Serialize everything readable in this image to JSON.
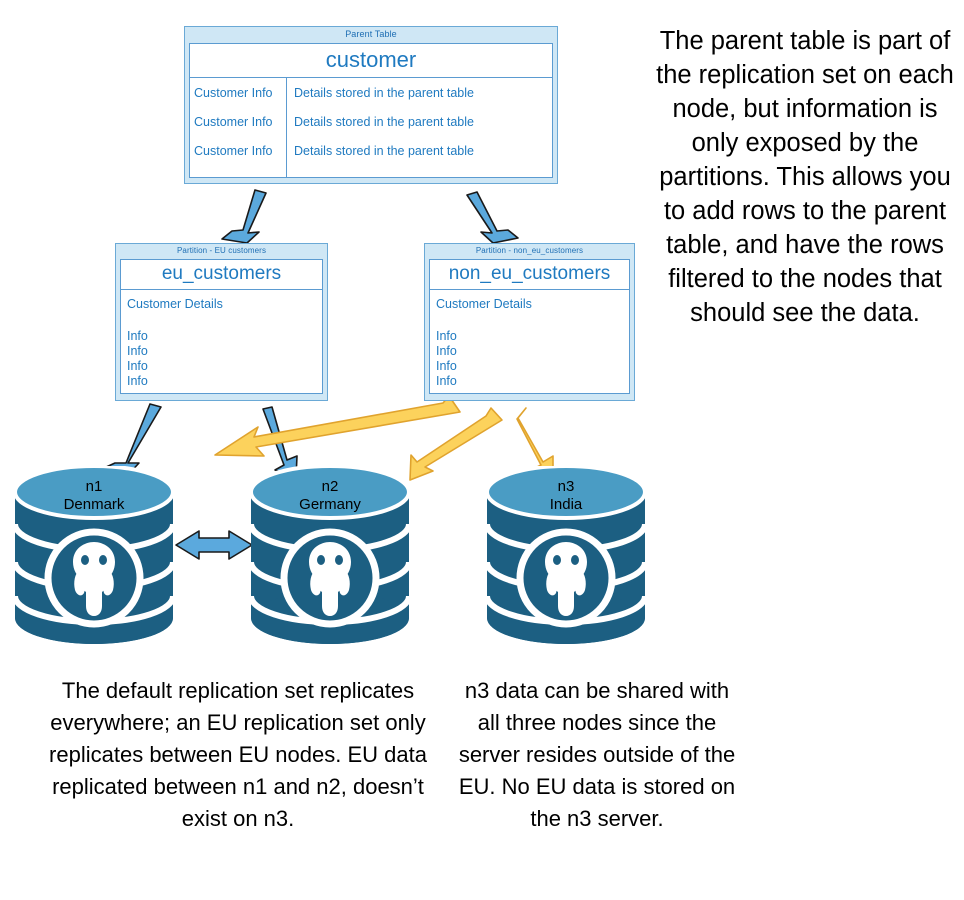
{
  "parent_table": {
    "caption": "Parent Table",
    "title": "customer",
    "rows": [
      {
        "label": "Customer Info",
        "detail": "Details stored in the parent table"
      },
      {
        "label": "Customer Info",
        "detail": "Details stored in the parent table"
      },
      {
        "label": "Customer Info",
        "detail": "Details stored in the parent table"
      }
    ]
  },
  "partitions": [
    {
      "id": "eu",
      "caption": "Partition - EU customers",
      "title": "eu_customers",
      "detail": "Customer Details",
      "info": [
        "Info",
        "Info",
        "Info",
        "Info"
      ]
    },
    {
      "id": "non_eu",
      "caption": "Partition - non_eu_customers",
      "title": "non_eu_customers",
      "detail": "Customer Details",
      "info": [
        "Info",
        "Info",
        "Info",
        "Info"
      ]
    }
  ],
  "nodes": [
    {
      "id": "n1",
      "name": "n1",
      "location": "Denmark"
    },
    {
      "id": "n2",
      "name": "n2",
      "location": "Germany"
    },
    {
      "id": "n3",
      "name": "n3",
      "location": "India"
    }
  ],
  "notes": {
    "parent_table_note": "The parent table is part of the replication set on each node, but information is only exposed by the partitions. This allows you to add rows to the parent table, and have the rows filtered to the nodes that should see the data.",
    "eu_caption": "The default replication set replicates everywhere; an EU replication set only replicates between EU nodes.  EU data replicated between n1 and n2, doesn’t exist on n3.",
    "n3_caption": "n3 data can be shared with all three nodes since the server resides outside of the EU.  No EU data is stored on the n3 server."
  },
  "colors": {
    "table_header_fill": "#cfe7f5",
    "table_border": "#5b9bd1",
    "table_text": "#1f7ac0",
    "blue_arrow": "#5ba9dd",
    "yellow_arrow": "#fcd25c",
    "node_body": "#1c5f82",
    "node_top": "#4a9cc4",
    "text": "#000000"
  },
  "arrows": [
    {
      "name": "parent-to-eu-partition",
      "color": "blue",
      "kind": "single"
    },
    {
      "name": "parent-to-non-eu-partition",
      "color": "blue",
      "kind": "single"
    },
    {
      "name": "eu-partition-to-n1",
      "color": "blue",
      "kind": "single"
    },
    {
      "name": "eu-partition-to-n2",
      "color": "blue",
      "kind": "single"
    },
    {
      "name": "non-eu-partition-to-n1",
      "color": "yellow",
      "kind": "single"
    },
    {
      "name": "non-eu-partition-to-n2",
      "color": "yellow",
      "kind": "single"
    },
    {
      "name": "non-eu-partition-to-n3",
      "color": "yellow",
      "kind": "single"
    },
    {
      "name": "n1-n2-replication",
      "color": "blue",
      "kind": "double"
    }
  ]
}
